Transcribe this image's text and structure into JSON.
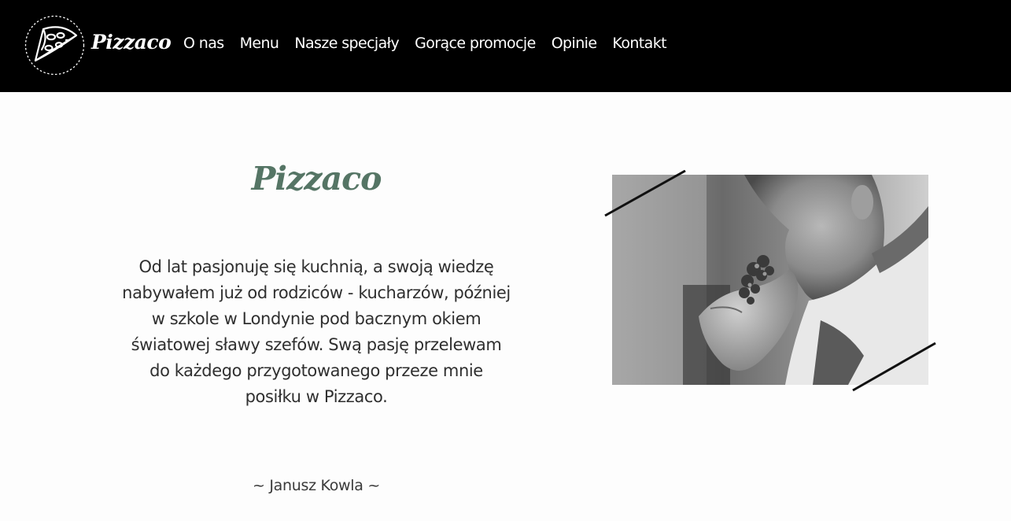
{
  "header": {
    "brand": "Pizzaco",
    "nav": [
      {
        "label": "O nas"
      },
      {
        "label": "Menu"
      },
      {
        "label": "Nasze specjały"
      },
      {
        "label": "Gorące promocje"
      },
      {
        "label": "Opinie"
      },
      {
        "label": "Kontakt"
      }
    ]
  },
  "about": {
    "title": "Pizzaco",
    "text": "Od lat pasjonuję się kuchnią, a swoją wiedzę nabywałem już od rodziców - kucharzów, później w szkole w Londynie pod bacznym okiem światowej sławy szefów. Swą pasję przelewam do każdego przygotowanego przeze mnie posiłku w Pizzaco.",
    "signature": "~ Janusz Kowla ~"
  },
  "colors": {
    "header_bg": "#000000",
    "accent": "#557565",
    "text": "#2f2f2f"
  }
}
